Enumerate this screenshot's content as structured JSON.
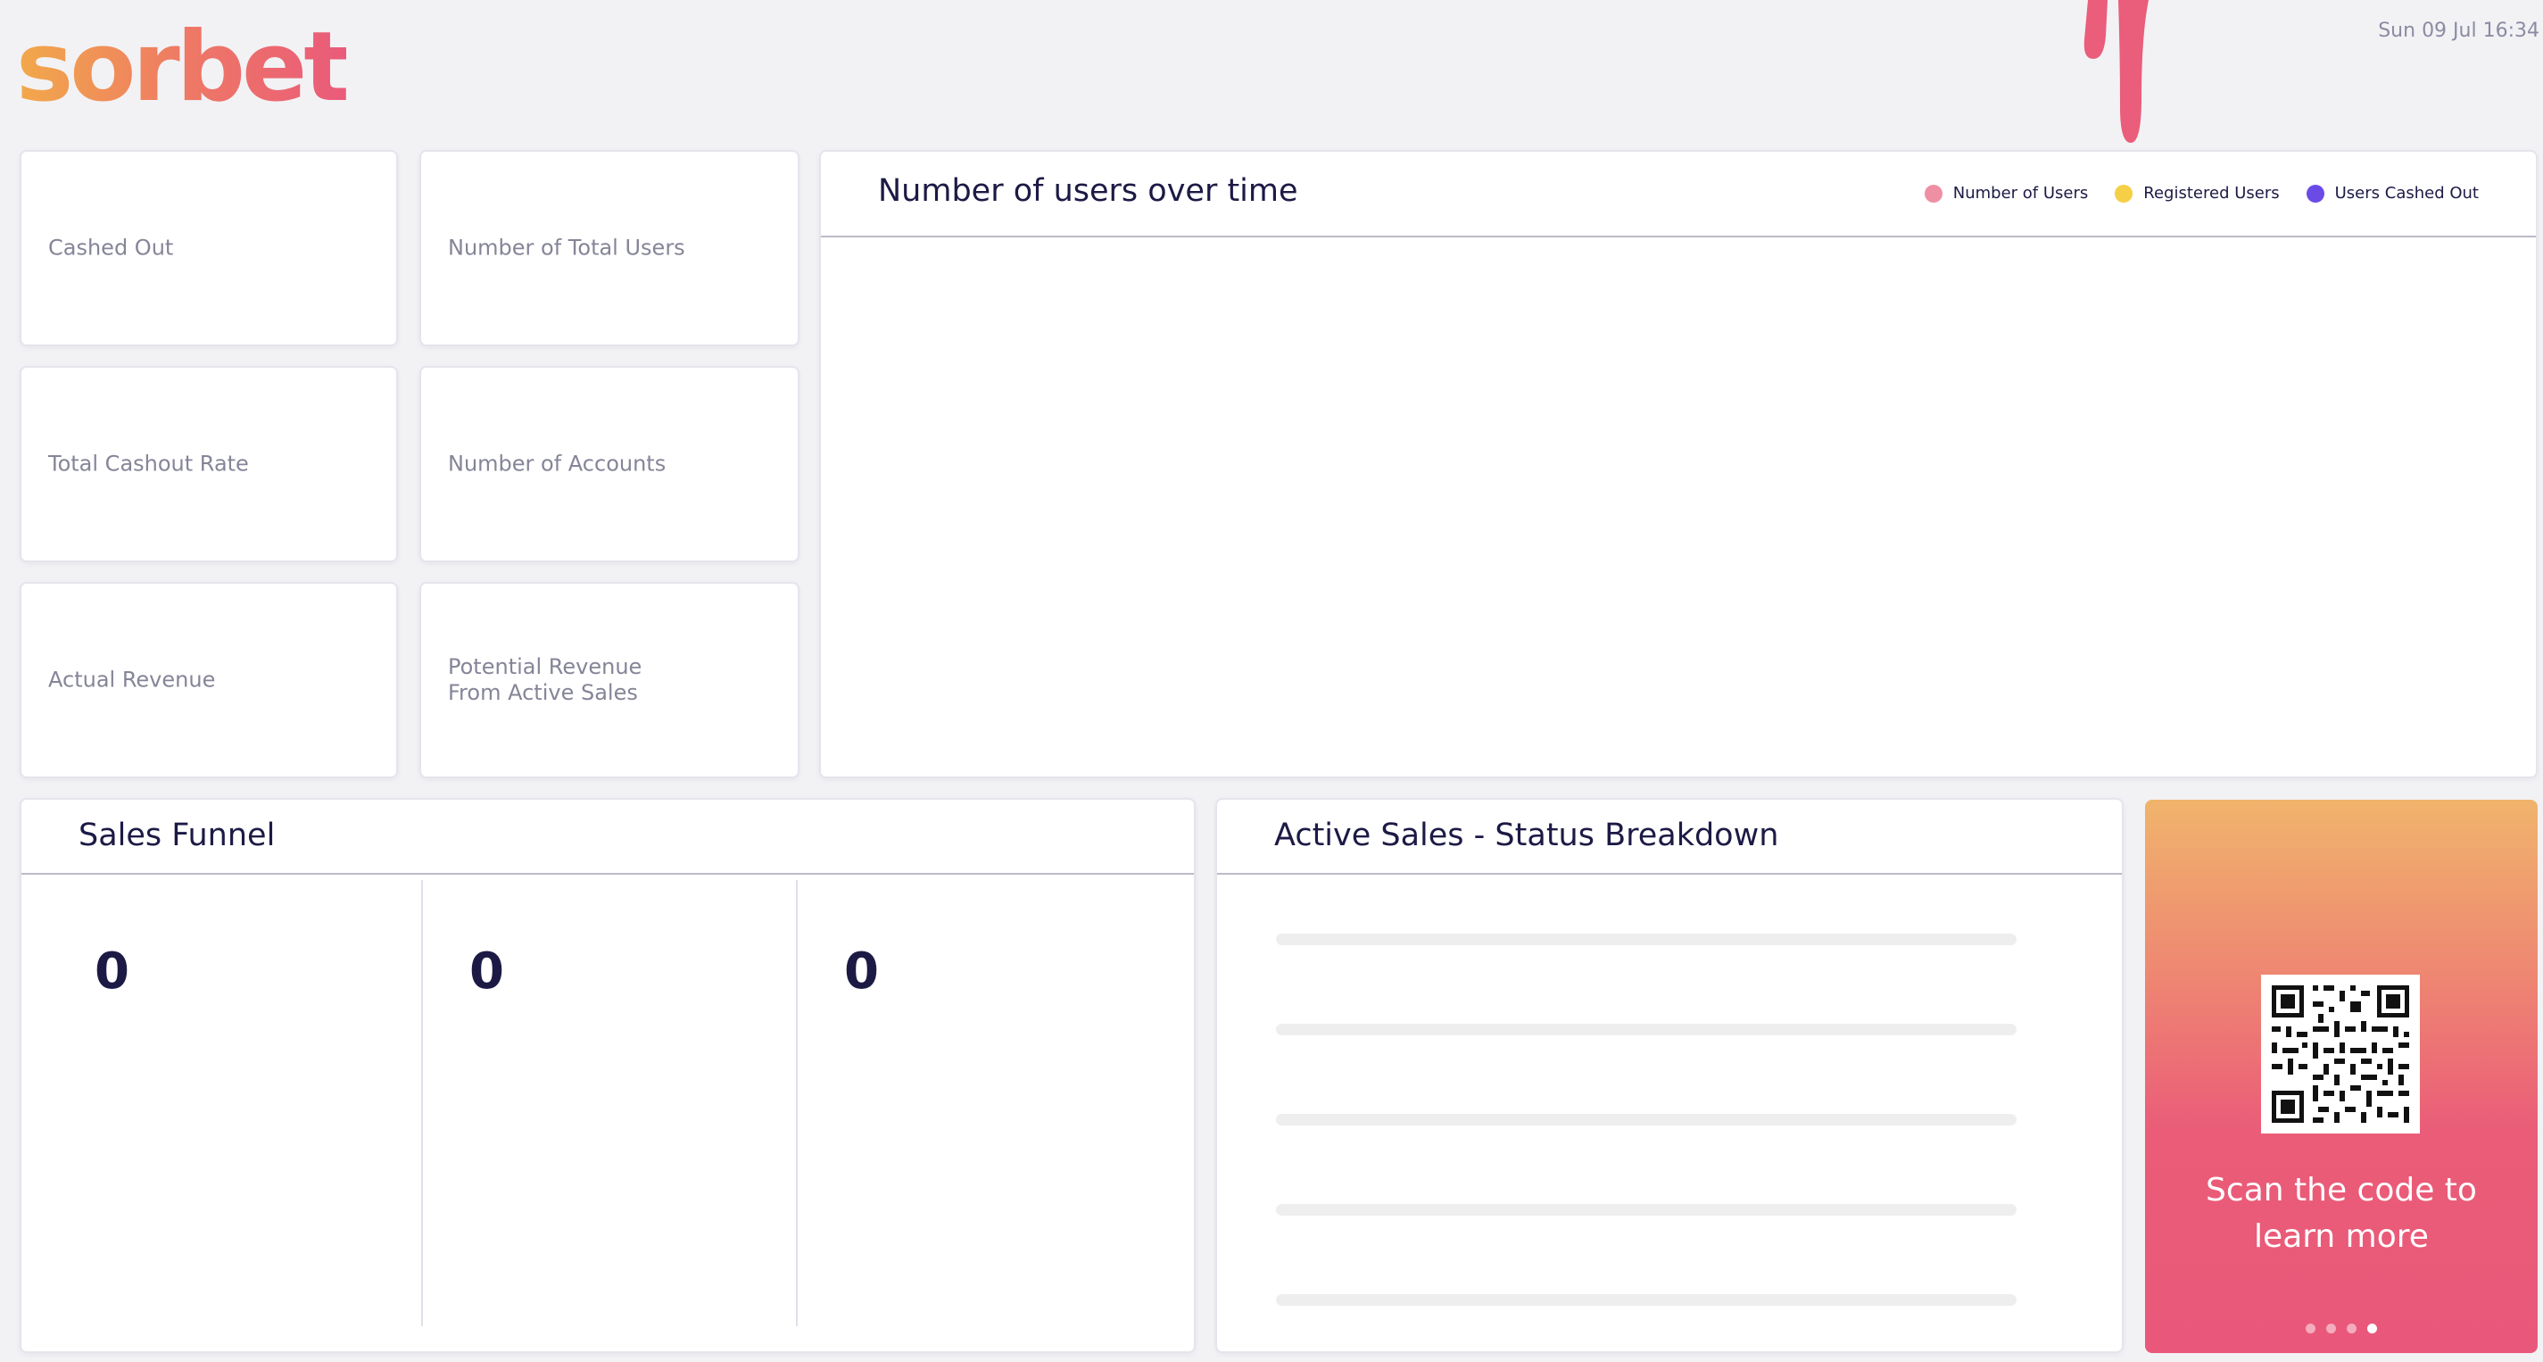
{
  "header": {
    "logo_text": "sorbet",
    "datetime": "Sun 09 Jul 16:34"
  },
  "stats": [
    {
      "label": "Cashed Out"
    },
    {
      "label": "Number of Total Users"
    },
    {
      "label": "Total Cashout Rate"
    },
    {
      "label": "Number of Accounts"
    },
    {
      "label": "Actual Revenue"
    },
    {
      "label": "Potential Revenue\nFrom Active Sales"
    }
  ],
  "users_chart": {
    "title": "Number of users over time",
    "legend": [
      {
        "name": "Number of Users",
        "color": "#ef8fa3"
      },
      {
        "name": "Registered Users",
        "color": "#f5cf45"
      },
      {
        "name": "Users Cashed Out",
        "color": "#6a4be6"
      }
    ]
  },
  "sales_funnel": {
    "title": "Sales Funnel",
    "values": [
      "0",
      "0",
      "0"
    ]
  },
  "active_sales": {
    "title": "Active Sales - Status Breakdown",
    "placeholder_rows": 5
  },
  "promo": {
    "text": "Scan the code to learn more",
    "pages": 4,
    "active_page": 4
  },
  "colors": {
    "brand_orange": "#f2a94a",
    "brand_pink": "#ea5a7a",
    "navy_text": "#1c1a45",
    "muted_text": "#858598"
  }
}
